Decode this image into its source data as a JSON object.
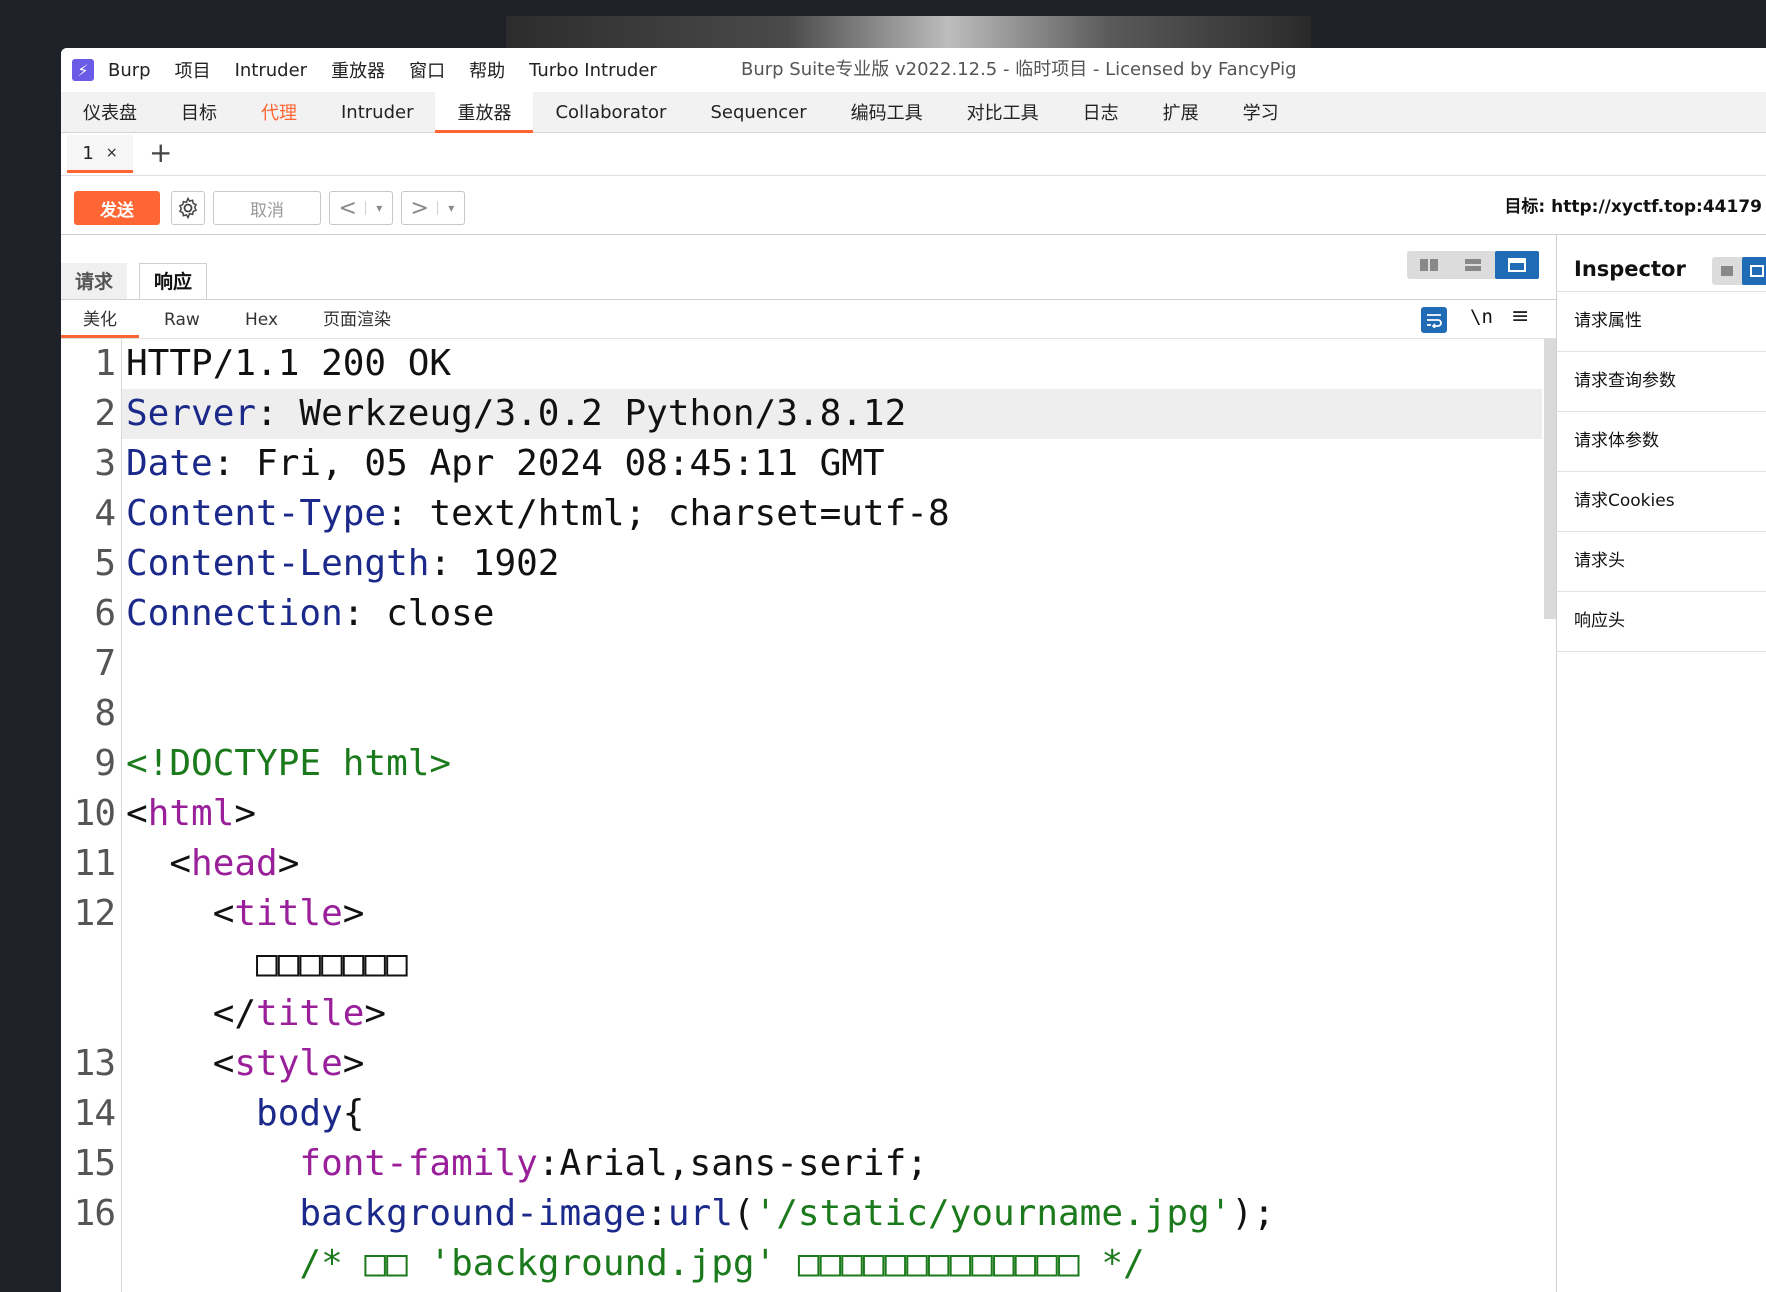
{
  "menubar": {
    "items": [
      "Burp",
      "项目",
      "Intruder",
      "重放器",
      "窗口",
      "帮助",
      "Turbo Intruder"
    ],
    "window_title": "Burp Suite专业版  v2022.12.5 - 临时项目 - Licensed by FancyPig"
  },
  "main_tabs": [
    "仪表盘",
    "目标",
    "代理",
    "Intruder",
    "重放器",
    "Collaborator",
    "Sequencer",
    "编码工具",
    "对比工具",
    "日志",
    "扩展",
    "学习"
  ],
  "repeater": {
    "tab_label": "1",
    "tab_close": "×",
    "add_tab": "+"
  },
  "toolbar": {
    "send": "发送",
    "cancel": "取消",
    "back": "<",
    "forward": ">",
    "dropdown": "▾",
    "target": "目标: http://xyctf.top:44179"
  },
  "panel": {
    "request_tab": "请求",
    "response_tab": "响应",
    "sub_tabs": [
      "美化",
      "Raw",
      "Hex",
      "页面渲染"
    ],
    "newline_toggle": "\\n",
    "menu": "≡"
  },
  "code": {
    "line_numbers": [
      "1",
      "2",
      "3",
      "4",
      "5",
      "6",
      "7",
      "8",
      "9",
      "10",
      "11",
      "12",
      "",
      "",
      "13",
      "14",
      "15",
      "16",
      ""
    ],
    "l1": "HTTP/1.1 200 OK",
    "l2_key": "Server",
    "l2_val": ": Werkzeug/3.0.2 Python/3.8.12",
    "l3_key": "Date",
    "l3_val": ": Fri, 05 Apr 2024 08:45:11 GMT",
    "l4_key": "Content-Type",
    "l4_val": ": text/html; charset=utf-8",
    "l5_key": "Content-Length",
    "l5_val": ": 1902",
    "l6_key": "Connection",
    "l6_val": ": close",
    "l9": "<!DOCTYPE html>",
    "l10_open": "<",
    "l10_tag": "html",
    "l10_close": ">",
    "l11_open": "  <",
    "l11_tag": "head",
    "l11_close": ">",
    "l12_open": "    <",
    "l12_tag": "title",
    "l12_close": ">",
    "l12_text": "      □□□□□□□",
    "l12b_open": "    </",
    "l12b_tag": "title",
    "l12b_close": ">",
    "l13_open": "    <",
    "l13_tag": "style",
    "l13_close": ">",
    "l14_sel": "      body",
    "l14_brace": "{",
    "l15_prop": "        font-family",
    "l15_val": ":Arial,sans-serif;",
    "l16_prop": "        background-image",
    "l16_colon": ":",
    "l16_func": "url",
    "l16_paren": "(",
    "l16_str": "'/static/yourname.jpg'",
    "l16_end": ");",
    "l17_comment": "        /* □□ 'background.jpg' □□□□□□□□□□□□□ */"
  },
  "inspector": {
    "title": "Inspector",
    "rows": [
      "请求属性",
      "请求查询参数",
      "请求体参数",
      "请求Cookies",
      "请求头",
      "响应头"
    ]
  },
  "colors": {
    "accent": "#ff6633",
    "selected_blue": "#1f6bb5",
    "header_key": "#1b2a8a",
    "tag": "#9a1f9a",
    "doctype": "#1b7a1b"
  }
}
